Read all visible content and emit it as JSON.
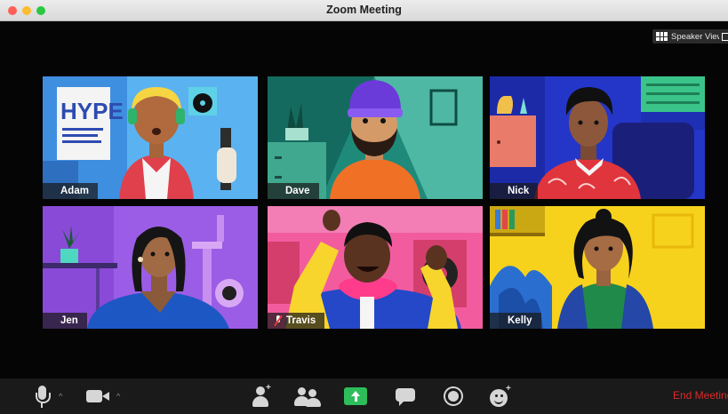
{
  "window": {
    "title": "Zoom Meeting"
  },
  "view_controls": {
    "speaker_view_label": "Speaker View"
  },
  "participants": [
    {
      "name": "Adam",
      "muted": false
    },
    {
      "name": "Dave",
      "muted": false
    },
    {
      "name": "Nick",
      "muted": false
    },
    {
      "name": "Jen",
      "muted": false
    },
    {
      "name": "Travis",
      "muted": true
    },
    {
      "name": "Kelly",
      "muted": false
    }
  ],
  "tile_art": {
    "adam": {
      "bg": "#3f8fe0",
      "poster_text": "HYPE"
    },
    "dave": {
      "bg": "#1f8a7a"
    },
    "nick": {
      "bg": "#2436c8"
    },
    "jen": {
      "bg": "#9b5de5"
    },
    "travis": {
      "bg": "#f25c9f"
    },
    "kelly": {
      "bg": "#f7d21c"
    }
  },
  "toolbar": {
    "items": [
      {
        "icon": "microphone-icon",
        "has_menu": true
      },
      {
        "icon": "video-camera-icon",
        "has_menu": true
      },
      {
        "icon": "invite-icon"
      },
      {
        "icon": "participants-icon"
      },
      {
        "icon": "share-screen-icon"
      },
      {
        "icon": "chat-icon"
      },
      {
        "icon": "record-icon"
      },
      {
        "icon": "reactions-icon"
      }
    ],
    "end_meeting_label": "End Meeting",
    "caret": "^"
  },
  "colors": {
    "end_meeting": "#e02828",
    "share_button": "#2dbd5a",
    "muted_mic": "#e23b3b"
  }
}
